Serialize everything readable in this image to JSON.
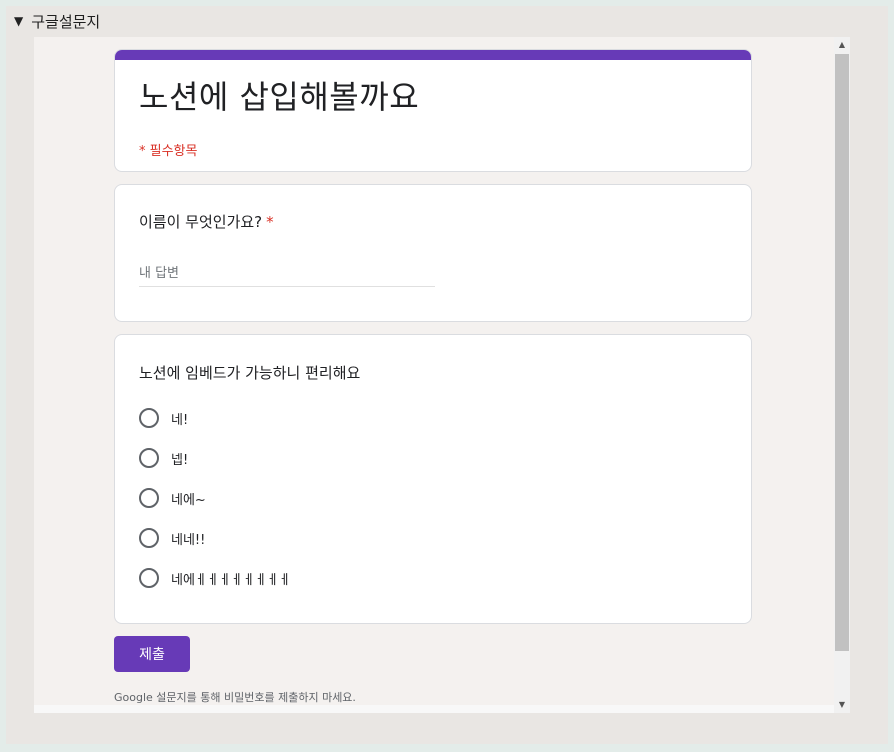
{
  "toggle": {
    "arrow": "▼",
    "title": "구글설문지"
  },
  "form": {
    "title": "노션에 삽입해볼까요",
    "required_note": "* 필수항목",
    "accent_color": "#673ab7",
    "questions": [
      {
        "label": "이름이 무엇인가요?",
        "required": "*",
        "placeholder": "내 답변"
      },
      {
        "label": "노션에 임베드가 가능하니 편리해요",
        "options": [
          "네!",
          "넵!",
          "네에~",
          "네네!!",
          "네에ㅔㅔㅔㅔㅔㅔㅔㅔ"
        ]
      }
    ],
    "submit_label": "제출",
    "footer_note": "Google 설문지를 통해 비밀번호를 제출하지 마세요."
  },
  "scrollbar": {
    "up_arrow": "▲",
    "down_arrow": "▼"
  }
}
